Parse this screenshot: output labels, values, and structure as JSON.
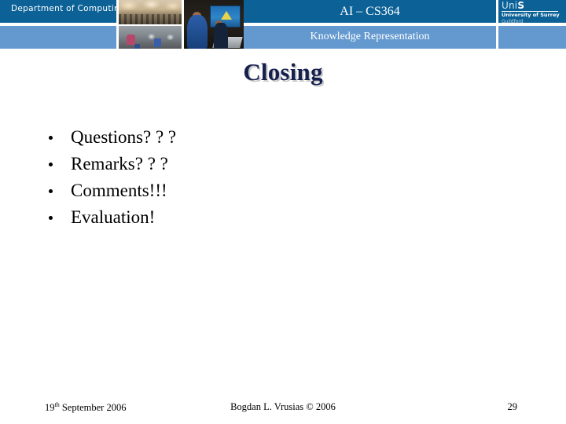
{
  "header": {
    "department_label": "Department of Computing",
    "course_title": "AI – CS364",
    "subtitle": "Knowledge Representation",
    "logo": {
      "mark_prefix": "Uni",
      "mark_suffix": "S",
      "university": "University of Surrey",
      "town": "Guildford"
    },
    "photos": [
      {
        "name": "lecture-hall-photo",
        "caption": "lecture hall audience"
      },
      {
        "name": "computer-lab-photo",
        "caption": "students at computer lab"
      },
      {
        "name": "students-laptop-photo",
        "caption": "two students at a laptop with projected screen"
      }
    ],
    "colors": {
      "dark_blue": "#0C6297",
      "mid_blue": "#6499CF",
      "text": "#FFFFFF"
    }
  },
  "slide": {
    "title": "Closing",
    "title_color": "#16204E",
    "title_shadow_color": "#C9C9C9",
    "bullets": [
      {
        "text": "Questions? ? ?"
      },
      {
        "text": "Remarks? ? ?"
      },
      {
        "text": "Comments!!!"
      },
      {
        "text": "Evaluation!"
      }
    ]
  },
  "footer": {
    "date_day": "19",
    "date_ordinal": "th",
    "date_rest": " September 2006",
    "author": "Bogdan L. Vrusias © 2006",
    "page_number": "29"
  }
}
